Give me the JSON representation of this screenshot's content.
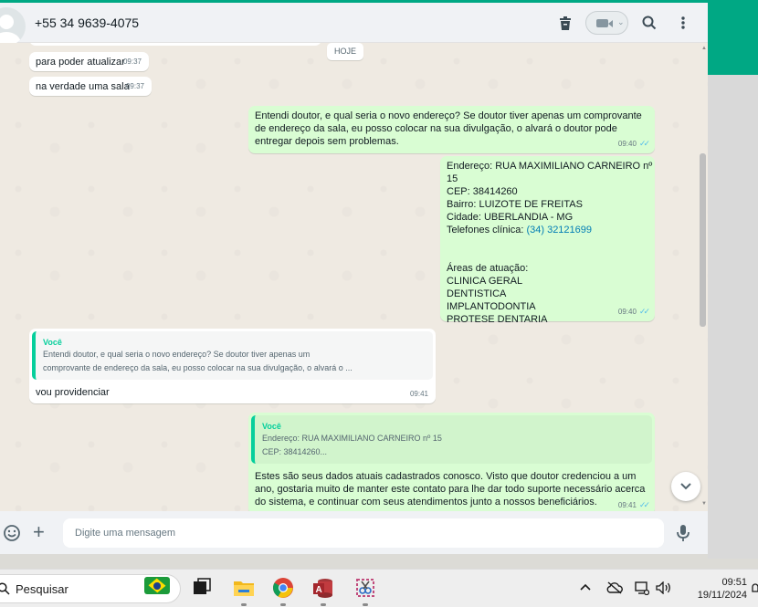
{
  "header": {
    "contact_name": "+55 34 9639-4075",
    "icons": [
      "trash-icon",
      "video-call-icon",
      "search-icon",
      "menu-icon"
    ]
  },
  "chat": {
    "date_chip": "HOJE",
    "messages": [
      {
        "text": "para poder atualizar",
        "time": "09:37"
      },
      {
        "text": "na verdade uma sala",
        "time": "09:37"
      },
      {
        "text": "Entendi doutor, e qual seria o novo endereço? Se doutor tiver apenas um comprovante de endereço da sala, eu posso colocar na sua divulgação, o alvará o doutor pode entregar depois sem problemas.",
        "time": "09:40"
      },
      {
        "lines": [
          "Endereço: RUA MAXIMILIANO CARNEIRO nº 15",
          "CEP: 38414260",
          "Bairro: LUIZOTE DE FREITAS",
          "Cidade: UBERLANDIA - MG",
          "Telefones clínica:"
        ],
        "phone": "(34) 32121699",
        "areas_title": "Áreas de atuação:",
        "areas": [
          "CLINICA GERAL",
          "DENTISTICA",
          "IMPLANTODONTIA",
          "PROTESE DENTARIA"
        ],
        "time": "09:40"
      },
      {
        "quote_author": "Você",
        "quote_text": "Entendi doutor, e qual seria o novo endereço? Se doutor tiver apenas um\ncomprovante de endereço da sala, eu posso colocar na sua divulgação, o alvará o ...",
        "text": "vou providenciar",
        "time": "09:41"
      },
      {
        "quote_author": "Você",
        "quote_text": "Endereço: RUA MAXIMILIANO CARNEIRO nº 15\nCEP: 38414260...",
        "text": "Estes são seus dados atuais cadastrados conosco. Visto que doutor credenciou a um ano, gostaria muito de manter este contato para lhe dar todo suporte necessário acerca do sistema, e continuar com seus atendimentos junto a nossos beneficiários.",
        "time": "09:41"
      }
    ]
  },
  "footer": {
    "placeholder": "Digite uma mensagem"
  },
  "taskbar": {
    "search_label": "Pesquisar",
    "time": "09:51",
    "date": "19/11/2024"
  },
  "colors": {
    "accent": "#00a884",
    "outgoing_bubble": "#d9fdd3",
    "incoming_bubble": "#ffffff",
    "read_ticks": "#53bdeb"
  }
}
